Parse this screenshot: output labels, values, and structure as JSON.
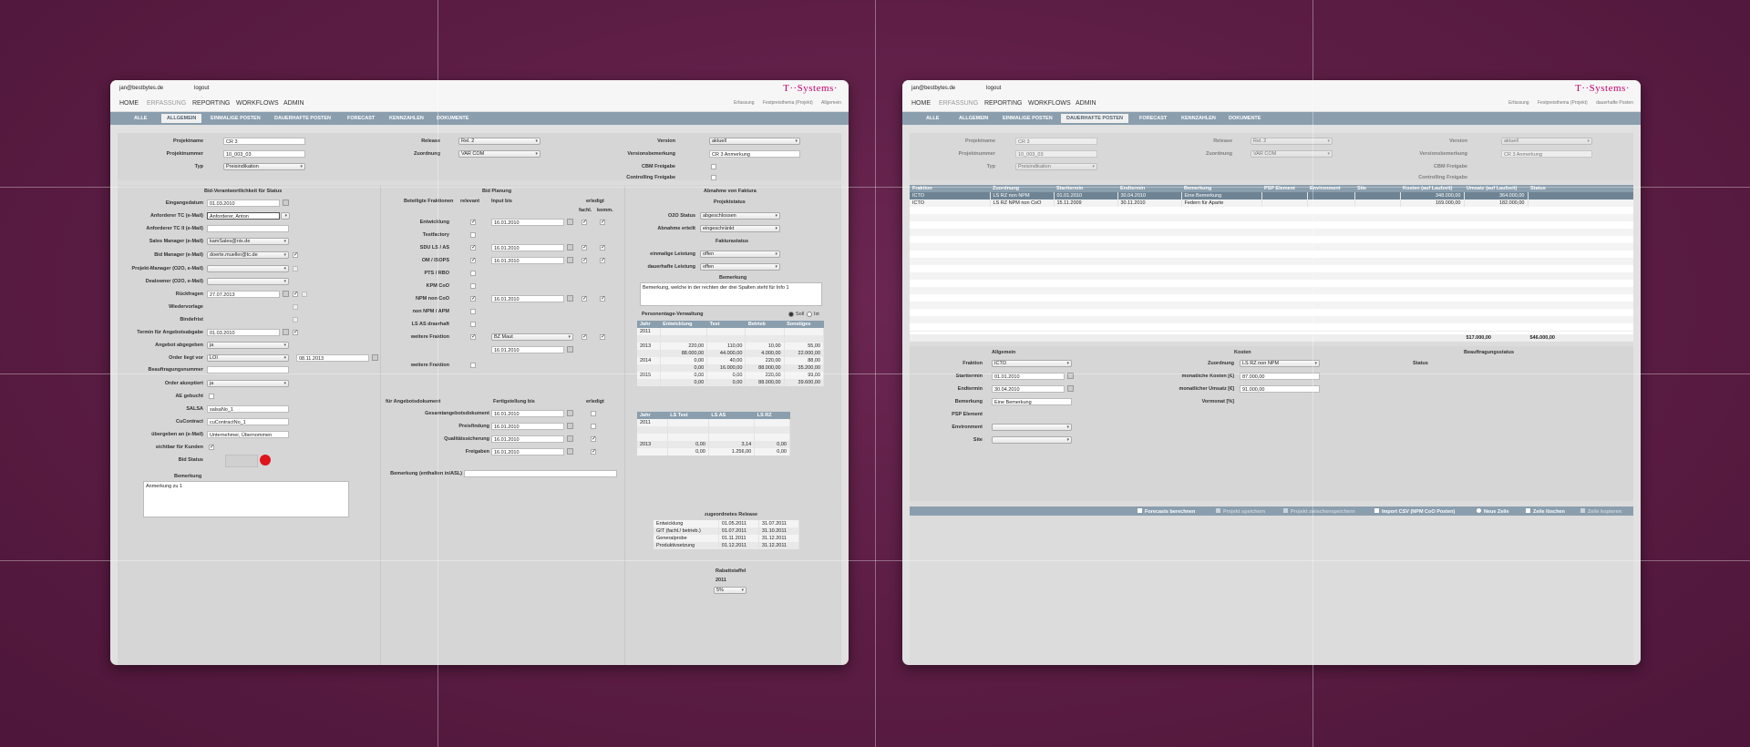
{
  "common": {
    "user_email": "jan@bestbytes.de",
    "logout_label": "logout",
    "logo_text": "T··Systems·",
    "menu": [
      "HOME",
      "ERFASSUNG",
      "REPORTING",
      "WORKFLOWS",
      "ADMIN"
    ],
    "tabs": [
      "ALLE",
      "ALLGEMEIN",
      "EINMALIGE POSTEN",
      "DAUERHAFTE POSTEN",
      "FORECAST",
      "KENNZAHLEN",
      "DOKUMENTE"
    ]
  },
  "left": {
    "crumbs": [
      "Erfassung",
      "Festpreisthema (Projekt)",
      "Allgemein"
    ],
    "top": {
      "projektname_label": "Projektname",
      "projektname": "CR 3",
      "projektnummer_label": "Projektnummer",
      "projektnummer": "10_003_03",
      "typ_label": "Typ",
      "typ": "Preisindikation",
      "release_label": "Release",
      "release": "Rel. 2",
      "zuordnung_label": "Zuordnung",
      "zuordnung": "VAR COM",
      "version_label": "Version",
      "version": "aktuell",
      "versionsbem_label": "Versionsbemerkung",
      "versionsbem": "CR 3 Anmerkung",
      "cbm_label": "CBM Freigabe",
      "controlling_label": "Controlling Freigabe"
    },
    "bid": {
      "header": "Bid-Verantwortlichkeit für Status",
      "eingang_label": "Eingangsdatum",
      "eingang": "01.03.2010",
      "anf_tc_label": "Anforderer TC (e-Mail)",
      "anf_tc": "Anforderer, Anton",
      "anf_tc2_label": "Anforderer TC II (e-Mail)",
      "sales_label": "Sales Manager (e-Mail)",
      "sales": "kamSales@nix.de",
      "bidmgr_label": "Bid Manager (e-Mail)",
      "bidmgr": "doerte.mueller@tc.de",
      "pm_label": "Projekt-Manager (O2O, e-Mail)",
      "deal_label": "Dealowner (O2O, e-Mail)",
      "rueck_label": "Rückfragen",
      "rueck": "27.07.2013",
      "wieder_label": "Wiedervorlage",
      "binde_label": "Bindefrist",
      "termin_label": "Termin für Angebotsabgabe",
      "termin": "01.03.2010",
      "abgegeben_label": "Angebot abgegeben",
      "abgegeben": "ja",
      "order_label": "Order liegt vor",
      "order": "LOI",
      "order_date": "08.11.2013",
      "beauftr_label": "Beauftragungsnummer",
      "akzept_label": "Order akzeptiert",
      "akzept": "ja",
      "ae_label": "AE gebucht",
      "salsa_label": "SALSA",
      "salsa": "salsaNo_1",
      "cucontract_label": "CuContract",
      "cucontract": "cuContractNo_1",
      "uebergeben_label": "übergeben an (e-Mail)",
      "uebergeben": "Unternehmer, Übernommen",
      "sichtbar_label": "sichtbar für Kunden",
      "bidstatus_label": "Bid Status",
      "bemerkung_label": "Bemerkung",
      "bemerkung": "Anmerkung zu 1"
    },
    "planung": {
      "header": "Bid Planung",
      "beteiligte": "Beteiligte Fraktionen",
      "relevant": "relevant",
      "inputbis": "Input bis",
      "erledigt": "erledigt",
      "fachl": "fachl.",
      "komm": "komm.",
      "rows": [
        {
          "label": "Entwicklung",
          "date": "16.01.2010"
        },
        {
          "label": "Testfactory",
          "date": ""
        },
        {
          "label": "SDU LS / AS",
          "date": "16.01.2010"
        },
        {
          "label": "OM / ISOPS",
          "date": "16.01.2010"
        },
        {
          "label": "PTS / RBO",
          "date": ""
        },
        {
          "label": "KPM CoO",
          "date": ""
        },
        {
          "label": "NPM non CoO",
          "date": "16.01.2010"
        },
        {
          "label": "non NPM / APM",
          "date": ""
        },
        {
          "label": "LS AS draerhaft",
          "date": ""
        },
        {
          "label": "weitere Fraktion",
          "date": ""
        }
      ],
      "weitere_sel": "BZ Maut",
      "weitere_date": "16.01.2010",
      "weitere2_label": "weitere Fraktion",
      "angebot_header": "für Angebotsdokument",
      "fertig_header": "Fertigstellung bis",
      "erledigt2": "erledigt",
      "dok_rows": [
        {
          "label": "Gesamtangebotsdokument",
          "date": "16.01.2010"
        },
        {
          "label": "Preisfindung",
          "date": "16.01.2010"
        },
        {
          "label": "Qualitätssicherung",
          "date": "16.01.2010"
        },
        {
          "label": "Freigaben",
          "date": "16.01.2010"
        }
      ],
      "bem_asl_label": "Bemerkung (enthalten in/ASL)"
    },
    "abnahme": {
      "header": "Abnahme von Faktura",
      "projektstatus": "Projektstatus",
      "o2o_label": "O2O Status",
      "o2o": "abgeschlossen",
      "abn_label": "Abnahme erteilt",
      "abn": "eingeschränkt",
      "faktura": "Fakturastatus",
      "einm_label": "einmalige Leistung",
      "einm": "offen",
      "dauer_label": "dauerhafte Leistung",
      "dauer": "offen",
      "bem_label": "Bemerkung",
      "bem": "Bemerkung, welche in der rechten der drei Spalten steht für Info 1",
      "pv_label": "Personentage-Verwaltung",
      "soll": "Soll",
      "ist": "Ist",
      "pv_cols": [
        "Jahr",
        "Entwicklung",
        "Test",
        "Betrieb",
        "Sonstiges"
      ],
      "pv_rows": [
        [
          "2011",
          "",
          "",
          "",
          ""
        ],
        [
          "",
          "",
          "",
          "",
          ""
        ],
        [
          "2013",
          "220,00",
          "110,00",
          "10,00",
          "55,00"
        ],
        [
          "",
          "88.000,00",
          "44.000,00",
          "4.000,00",
          "22.000,00"
        ],
        [
          "2014",
          "0,00",
          "40,00",
          "220,00",
          "88,00"
        ],
        [
          "",
          "0,00",
          "16.000,00",
          "88.000,00",
          "35.200,00"
        ],
        [
          "2015",
          "0,00",
          "0,00",
          "220,00",
          "99,00"
        ],
        [
          "",
          "0,00",
          "0,00",
          "88.000,00",
          "39.600,00"
        ]
      ],
      "ls_cols": [
        "Jahr",
        "LS Test",
        "LS AS",
        "LS RZ"
      ],
      "ls_rows": [
        [
          "2011",
          "",
          "",
          ""
        ],
        [
          "",
          "",
          "",
          ""
        ],
        [
          "",
          "",
          "",
          ""
        ],
        [
          "2013",
          "0,00",
          "3,14",
          "0,00"
        ],
        [
          "",
          "0,00",
          "1.256,00",
          "0,00"
        ]
      ],
      "release_header": "zugeordnetes Release",
      "release_rows": [
        [
          "Entwicklung",
          "01.05.2011",
          "31.07.2011"
        ],
        [
          "GIT (fachl./ betrieb.)",
          "01.07.2011",
          "31.10.2011"
        ],
        [
          "Generalprobe",
          "01.11.2011",
          "31.12.2011"
        ],
        [
          "Produktivsetzung",
          "01.12.2011",
          "31.12.2011"
        ]
      ],
      "rabatt_label": "Rabattstaffel",
      "rabatt_year": "2011",
      "rabatt": "5%"
    }
  },
  "right": {
    "crumbs": [
      "Erfassung",
      "Festpreisthema (Projekt)",
      "dauerhafte Posten"
    ],
    "top": {
      "projektname": "CR 3",
      "projektnummer": "10_003_03",
      "typ": "Preisindikation",
      "release": "Rel. 2",
      "zuordnung": "VAR COM",
      "version": "aktuell",
      "versionsbem": "CR 3 Anmerkung"
    },
    "grid_cols": [
      "Fraktion",
      "Zuordnung",
      "Starttermin",
      "Endtermin",
      "Bemerkung",
      "PSP Element",
      "Environment",
      "Site",
      "Kosten (auf Laufzeit)",
      "Umsatz (auf Laufzeit)",
      "Status"
    ],
    "grid_rows": [
      [
        "ICTO",
        "LS RZ non NPM",
        "01.01.2010",
        "30.04.2010",
        "Eine Bemerkung",
        "",
        "",
        "",
        "348.000,00",
        "364.000,00",
        ""
      ],
      [
        "ICTO",
        "LS RZ NPM non CoO",
        "15.11.2009",
        "30.11.2010",
        "Federn für Aparte",
        "",
        "",
        "",
        "169.000,00",
        "182.000,00",
        ""
      ]
    ],
    "grid_totals": [
      "517.000,00",
      "546.000,00"
    ],
    "detail": {
      "allgemein": "Allgemein",
      "kosten": "Kosten",
      "beauftragung": "Beauftragungsstatus",
      "fraktion_label": "Fraktion",
      "fraktion": "ICTO",
      "start_label": "Starttermin",
      "start": "01.01.2010",
      "end_label": "Endtermin",
      "end": "30.04.2010",
      "bem_label": "Bemerkung",
      "bem": "Eine Bemerkung",
      "psp_label": "PSP Element",
      "env_label": "Environment",
      "site_label": "Site",
      "zuordnung_label": "Zuordnung",
      "zuordnung": "LS RZ non NPM",
      "mk_label": "monatliche Kosten [€]",
      "mk": "87.000,00",
      "mu_label": "monatlicher Umsatz [€]",
      "mu": "91.000,00",
      "marge_label": "Vormonat [%]",
      "status_label": "Status"
    },
    "footer": [
      "Forecasts berechnen",
      "Projekt speichern",
      "Projekt zwischenspeichern",
      "Import CSV (NPM CoO Posten)",
      "Neue Zeile",
      "Zeile löschen",
      "Zeile kopieren"
    ]
  }
}
